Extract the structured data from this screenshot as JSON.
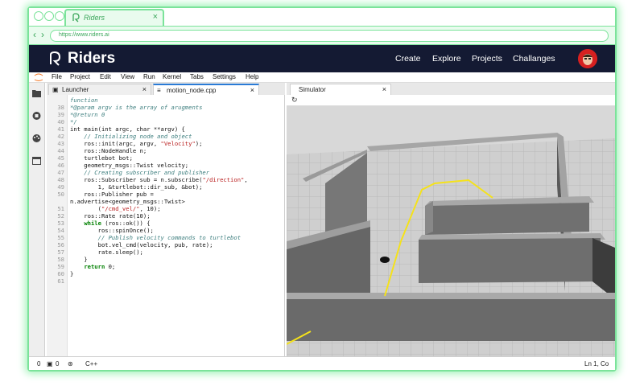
{
  "browser": {
    "tab_title": "Riders",
    "tab_close": "×",
    "url": "https://www.riders.ai",
    "back_glyph": "‹",
    "forward_glyph": "›"
  },
  "header": {
    "brand": "Riders",
    "nav": [
      "Create",
      "Explore",
      "Projects",
      "Challanges"
    ]
  },
  "menu": [
    "File",
    "Project",
    "Edit",
    "View",
    "Run",
    "Kernel",
    "Tabs",
    "Settings",
    "Help"
  ],
  "sidebar_icons": [
    "folder-icon",
    "stop-circle-icon",
    "palette-icon",
    "window-icon"
  ],
  "editor": {
    "tabs": [
      {
        "label": "Launcher",
        "icon": "launcher-icon",
        "close": "×"
      },
      {
        "label": "motion_node.cpp",
        "icon": "file-icon",
        "close": "×"
      }
    ],
    "lines": [
      {
        "n": "",
        "segs": [
          {
            "t": "function",
            "c": "c-com"
          }
        ]
      },
      {
        "n": "38",
        "segs": [
          {
            "t": "*@param argv is the array of arugments",
            "c": "c-com"
          }
        ]
      },
      {
        "n": "39",
        "segs": [
          {
            "t": "*@return 0",
            "c": "c-com"
          }
        ]
      },
      {
        "n": "40",
        "segs": [
          {
            "t": "*/",
            "c": "c-com"
          }
        ]
      },
      {
        "n": "41",
        "segs": [
          {
            "t": "int main(int argc, char **argv) {",
            "c": ""
          }
        ]
      },
      {
        "n": "42",
        "segs": [
          {
            "t": "    // Initializing node and object",
            "c": "c-com"
          }
        ]
      },
      {
        "n": "43",
        "segs": [
          {
            "t": "    ros::init(argc, argv, ",
            "c": ""
          },
          {
            "t": "\"Velocity\"",
            "c": "c-str"
          },
          {
            "t": ");",
            "c": ""
          }
        ]
      },
      {
        "n": "44",
        "segs": [
          {
            "t": "    ros::NodeHandle n;",
            "c": ""
          }
        ]
      },
      {
        "n": "45",
        "segs": [
          {
            "t": "    turtlebot bot;",
            "c": ""
          }
        ]
      },
      {
        "n": "46",
        "segs": [
          {
            "t": "    geometry_msgs::Twist velocity;",
            "c": ""
          }
        ]
      },
      {
        "n": "47",
        "segs": [
          {
            "t": "    // Creating subscriber and publisher",
            "c": "c-com"
          }
        ]
      },
      {
        "n": "48",
        "segs": [
          {
            "t": "    ros::Subscriber sub = n.subscribe(",
            "c": ""
          },
          {
            "t": "\"/direction\"",
            "c": "c-str"
          },
          {
            "t": ",",
            "c": ""
          }
        ]
      },
      {
        "n": "49",
        "segs": [
          {
            "t": "        1, &turtlebot::dir_sub, &bot);",
            "c": ""
          }
        ]
      },
      {
        "n": "50",
        "segs": [
          {
            "t": "    ros::Publisher pub =",
            "c": ""
          }
        ]
      },
      {
        "n": "",
        "segs": [
          {
            "t": "n.advertise<geometry_msgs::Twist>",
            "c": ""
          }
        ]
      },
      {
        "n": "51",
        "segs": [
          {
            "t": "        (",
            "c": ""
          },
          {
            "t": "\"/cmd_vel/\"",
            "c": "c-str"
          },
          {
            "t": ", 10);",
            "c": ""
          }
        ]
      },
      {
        "n": "52",
        "segs": [
          {
            "t": "    ros::Rate rate(10);",
            "c": ""
          }
        ]
      },
      {
        "n": "53",
        "segs": [
          {
            "t": "    ",
            "c": ""
          },
          {
            "t": "while",
            "c": "c-kw"
          },
          {
            "t": " (ros::ok()) {",
            "c": ""
          }
        ]
      },
      {
        "n": "54",
        "segs": [
          {
            "t": "        ros::spinOnce();",
            "c": ""
          }
        ]
      },
      {
        "n": "55",
        "segs": [
          {
            "t": "        // Publish velocity commands to turtlebot",
            "c": "c-com"
          }
        ]
      },
      {
        "n": "56",
        "segs": [
          {
            "t": "        bot.vel_cmd(velocity, pub, rate);",
            "c": ""
          }
        ]
      },
      {
        "n": "57",
        "segs": [
          {
            "t": "        rate.sleep();",
            "c": ""
          }
        ]
      },
      {
        "n": "58",
        "segs": [
          {
            "t": "    }",
            "c": ""
          }
        ]
      },
      {
        "n": "59",
        "segs": [
          {
            "t": "    ",
            "c": ""
          },
          {
            "t": "return",
            "c": "c-kw"
          },
          {
            "t": " 0;",
            "c": ""
          }
        ]
      },
      {
        "n": "60",
        "segs": [
          {
            "t": "}",
            "c": ""
          }
        ]
      },
      {
        "n": "61",
        "segs": [
          {
            "t": "",
            "c": ""
          }
        ]
      }
    ]
  },
  "simulator": {
    "tab_label": "Simulator",
    "tab_close": "×",
    "refresh_glyph": "↻"
  },
  "status": {
    "count": "0",
    "mode_count": "0",
    "language": "C++",
    "position": "Ln 1, Co"
  },
  "colors": {
    "accent_green": "#7be39a",
    "header_bg": "#141a33",
    "line_yellow": "#f5e21a"
  }
}
